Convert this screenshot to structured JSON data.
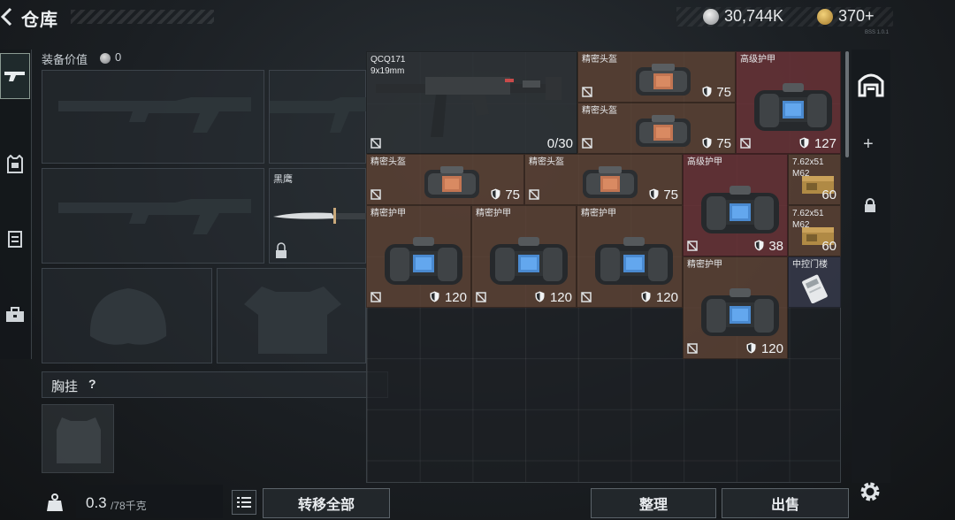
{
  "header": {
    "title": "仓库",
    "silver_amount": "30,744K",
    "gold_amount": "370+",
    "version": "BSS 1.0.1"
  },
  "equipment": {
    "label": "装备价值",
    "value": "0",
    "melee_name": "黑鹰",
    "chest_rig_label": "胸挂",
    "chest_rig_help": "?"
  },
  "storage_items": [
    {
      "name": "QCQ171",
      "sub": "9x19mm",
      "value": "0/30",
      "color": "dark",
      "kind": "gun"
    },
    {
      "name": "精密头盔",
      "value": "75",
      "color": "brown",
      "kind": "helmet"
    },
    {
      "name": "精密头盔",
      "value": "75",
      "color": "brown",
      "kind": "helmet"
    },
    {
      "name": "高级护甲",
      "value": "127",
      "color": "red",
      "kind": "armor"
    },
    {
      "name": "精密头盔",
      "value": "75",
      "color": "brown",
      "kind": "helmet"
    },
    {
      "name": "精密头盔",
      "value": "75",
      "color": "brown",
      "kind": "helmet"
    },
    {
      "name": "高级护甲",
      "value": "38",
      "color": "red",
      "kind": "armor"
    },
    {
      "name": "7.62x51",
      "sub": "M62",
      "value": "60",
      "color": "brown",
      "kind": "ammo"
    },
    {
      "name": "7.62x51",
      "sub": "M62",
      "value": "60",
      "color": "brown",
      "kind": "ammo"
    },
    {
      "name": "精密护甲",
      "value": "120",
      "color": "brown",
      "kind": "armor"
    },
    {
      "name": "精密护甲",
      "value": "120",
      "color": "brown",
      "kind": "armor"
    },
    {
      "name": "精密护甲",
      "value": "120",
      "color": "brown",
      "kind": "armor"
    },
    {
      "name": "精密护甲",
      "value": "120",
      "color": "brown",
      "kind": "armor"
    },
    {
      "name": "中控门楼",
      "value": "",
      "color": "blue",
      "kind": "keycard"
    }
  ],
  "footer": {
    "weight_current": "0.3",
    "weight_max": "/78千克",
    "transfer_all": "转移全部",
    "tidy": "整理",
    "sell": "出售"
  },
  "colors": {
    "brown_item": "#664837",
    "red_item": "#703438",
    "accent_gold": "#d9b04b"
  }
}
